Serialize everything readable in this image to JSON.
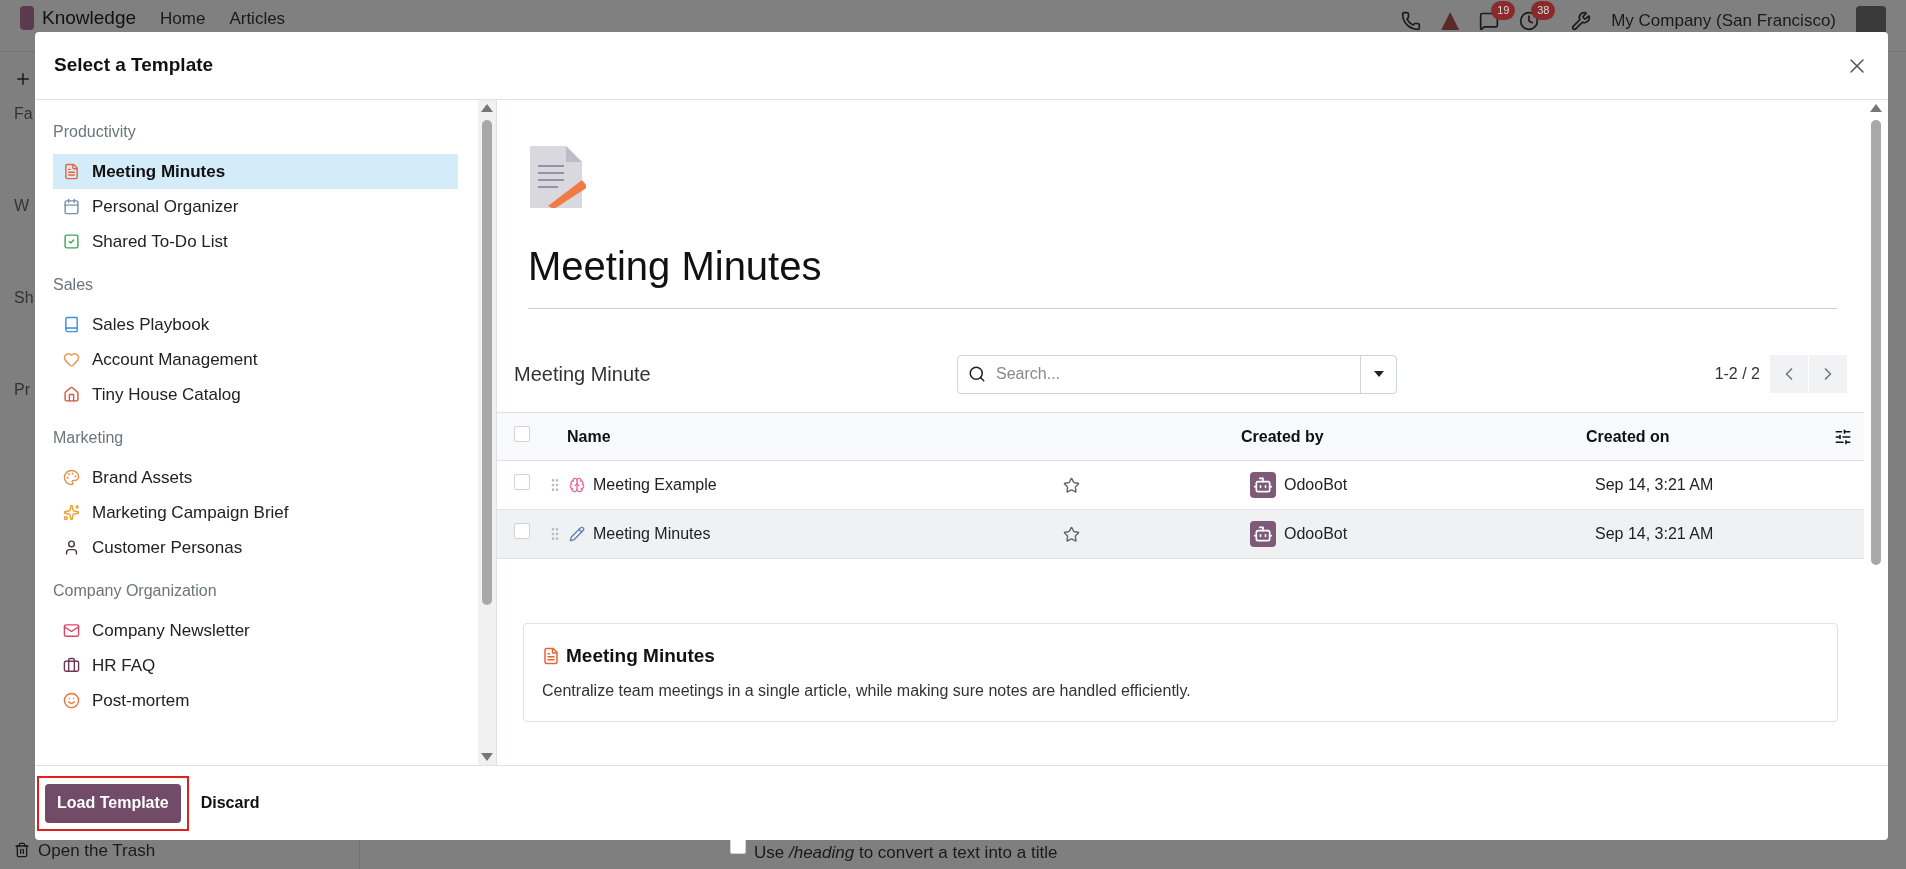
{
  "app_bar": {
    "app_name": "Knowledge",
    "menu": [
      "Home",
      "Articles"
    ],
    "badges": [
      {
        "count": "19"
      },
      {
        "count": "38"
      }
    ],
    "company": "My Company (San Francisco)"
  },
  "background": {
    "sidebar_fragments": [
      "Fa",
      "W",
      "Sh",
      "Pr"
    ],
    "trash_link": "Open the Trash",
    "hint_checked": false,
    "hint": "Use */heading* to convert a text into a title"
  },
  "dialog": {
    "title": "Select a Template",
    "categories": [
      {
        "name": "Productivity",
        "templates": [
          {
            "label": "Meeting Minutes",
            "selected": true
          },
          {
            "label": "Personal Organizer",
            "selected": false
          },
          {
            "label": "Shared To-Do List",
            "selected": false
          }
        ]
      },
      {
        "name": "Sales",
        "templates": [
          {
            "label": "Sales Playbook",
            "selected": false
          },
          {
            "label": "Account Management",
            "selected": false
          },
          {
            "label": "Tiny House Catalog",
            "selected": false
          }
        ]
      },
      {
        "name": "Marketing",
        "templates": [
          {
            "label": "Brand Assets",
            "selected": false
          },
          {
            "label": "Marketing Campaign Brief",
            "selected": false
          },
          {
            "label": "Customer Personas",
            "selected": false
          }
        ]
      },
      {
        "name": "Company Organization",
        "templates": [
          {
            "label": "Company Newsletter",
            "selected": false
          },
          {
            "label": "HR FAQ",
            "selected": false
          },
          {
            "label": "Post-mortem",
            "selected": false
          }
        ]
      }
    ],
    "preview": {
      "title": "Meeting Minutes",
      "list_title": "Meeting Minute",
      "search": {
        "placeholder": "Search..."
      },
      "select_all_checked": false,
      "pager": "1-2 / 2",
      "columns": [
        "Name",
        "Created by",
        "Created on"
      ],
      "rows": [
        {
          "name": "Meeting Example",
          "created_by": "OdooBot",
          "created_on": "Sep 14, 3:21 AM",
          "checked": false,
          "starred": false,
          "selected": false
        },
        {
          "name": "Meeting Minutes",
          "created_by": "OdooBot",
          "created_on": "Sep 14, 3:21 AM",
          "checked": false,
          "starred": false,
          "selected": true
        }
      ],
      "summary": {
        "title": "Meeting Minutes",
        "description": "Centralize team meetings in a single article, while making sure notes are handled efficiently."
      }
    },
    "buttons": {
      "primary": "Load Template",
      "secondary": "Discard"
    }
  }
}
